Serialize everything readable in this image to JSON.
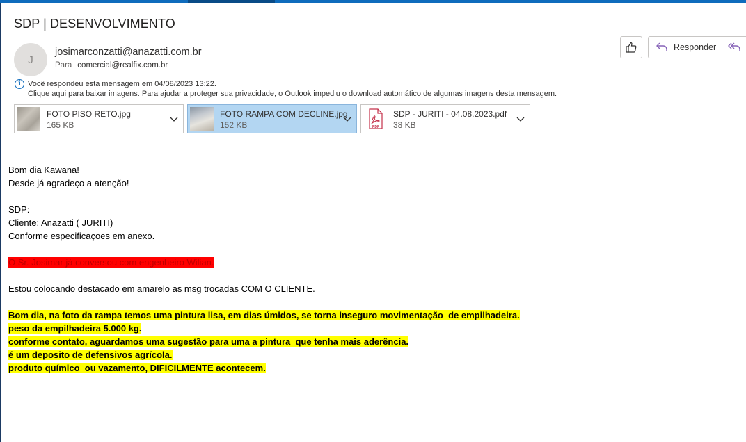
{
  "subject": "SDP | DESENVOLVIMENTO",
  "sender": {
    "avatar_initial": "J",
    "email": "josimarconzatti@anazatti.com.br",
    "to_label": "Para",
    "to_address": "comercial@realfix.com.br"
  },
  "actions": {
    "like_icon": "thumbs-up-icon",
    "reply_label": "Responder",
    "reply_icon": "reply-icon",
    "reply_all_icon": "reply-all-icon"
  },
  "info": {
    "line1": "Você respondeu esta mensagem em 04/08/2023 13:22.",
    "line2": "Clique aqui para baixar imagens. Para ajudar a proteger sua privacidade, o Outlook impediu o download automático de algumas imagens desta mensagem."
  },
  "attachments": [
    {
      "name": "FOTO PISO RETO.jpg",
      "size": "165 KB",
      "selected": false
    },
    {
      "name": "FOTO RAMPA COM DECLINE.jpg",
      "size": "152 KB",
      "selected": true
    },
    {
      "name": "SDP - JURITI - 04.08.2023.pdf",
      "size": "38 KB",
      "selected": false
    }
  ],
  "body": {
    "greeting": "Bom dia Kawana!",
    "thanks": "Desde já agradeço a atenção!",
    "sdp": "SDP:",
    "client": "Cliente: Anazatti ( JURITI)",
    "specs": "Conforme especificaçoes em anexo.",
    "red_note": "O Sr. Josimar já conversou com engenheiro Wilian.",
    "yellow_intro": "Estou colocando destacado em amarelo as msg trocadas COM O CLIENTE.",
    "yellow_lines": [
      "Bom dia, na foto da rampa temos uma pintura lisa, em dias úmidos, se torna inseguro movimentação  de empilhadeira.",
      "peso da empilhadeira 5.000 kg.",
      "conforme contato, aguardamos uma sugestão para uma a pintura  que tenha mais aderência.",
      "é um deposito de defensivos agrícola.",
      "produto químico  ou vazamento, DIFICILMENTE acontecem."
    ]
  },
  "colors": {
    "accent": "#0f6cbd",
    "highlight_red": "#ff0000",
    "highlight_yellow": "#ffff00",
    "selected_attachment": "#b3d6f2"
  }
}
